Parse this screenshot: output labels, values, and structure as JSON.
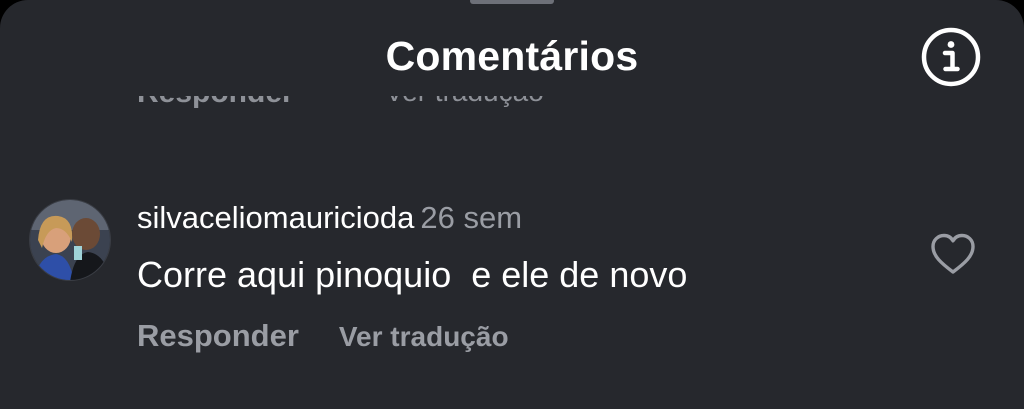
{
  "header": {
    "title": "Comentários",
    "info_icon": "info-icon"
  },
  "previous_comment": {
    "reply_label": "Responder",
    "translate_label": "Ver tradução"
  },
  "comment": {
    "username": "silvaceliomauricioda",
    "time": "26 sem",
    "text": "Corre aqui pinoquio  e ele de novo",
    "reply_label": "Responder",
    "translate_label": "Ver tradução",
    "like_icon": "heart-outline-icon"
  },
  "colors": {
    "background": "#26282d",
    "primary_text": "#ffffff",
    "secondary_text": "#9a9da4"
  }
}
